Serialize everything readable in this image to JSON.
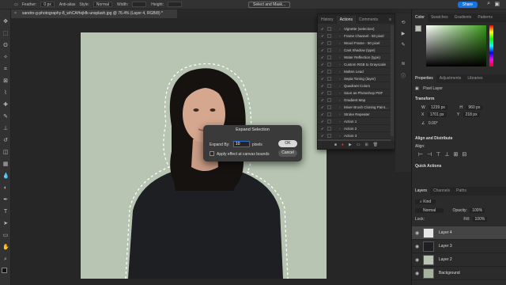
{
  "options_bar": {
    "feather_label": "Feather:",
    "feather_value": "0 px",
    "antialias_label": "Anti-alias",
    "style_label": "Style:",
    "style_value": "Normal",
    "width_label": "Width:",
    "height_label": "Height:",
    "select_mask_label": "Select and Mask...",
    "share_label": "Share"
  },
  "document_tab": {
    "title": "sandro-g-photography-8_whCAHejkfk-unsplash.jpg @ 76.4% (Layer 4, RGB/8) *"
  },
  "actions_panel": {
    "tabs": [
      "History",
      "Actions",
      "Comments"
    ],
    "active_tab": "Actions",
    "items": [
      "Vignette (selection)",
      "Frame Channel - 50 pixel",
      "Wood Frame - 50 pixel",
      "Cast Shadow (type)",
      "Water Reflection (type)",
      "Custom RGB to Grayscale",
      "Molten Lead",
      "Sepia Toning (layer)",
      "Quadrant Colors",
      "Save as Photoshop PDF",
      "Gradient Map",
      "Mixer Brush Cloning Paint...",
      "Stroke Repeater",
      "Action 1",
      "Action 2",
      "Action 3",
      "Repeated Outline"
    ],
    "selected_item": "Repeated Outline"
  },
  "dialog": {
    "title": "Expand Selection",
    "expand_label": "Expand By:",
    "expand_value": "10",
    "unit": "pixels",
    "checkbox_label": "Apply effect at canvas bounds",
    "ok_label": "OK",
    "cancel_label": "Cancel"
  },
  "color_panel": {
    "tabs": [
      "Color",
      "Swatches",
      "Gradients",
      "Patterns"
    ],
    "foreground": "#b7c5b2"
  },
  "properties_panel": {
    "tabs": [
      "Properties",
      "Adjustments",
      "Libraries"
    ],
    "kind": "Pixel Layer",
    "transform_header": "Transform",
    "w_label": "W",
    "w_value": "1239 px",
    "h_label": "H",
    "h_value": "960 px",
    "x_label": "X",
    "x_value": "1701 px",
    "y_label": "Y",
    "y_value": "218 px",
    "angle_value": "0.00°",
    "align_header": "Align and Distribute",
    "align_sub": "Align:",
    "quick_actions_header": "Quick Actions"
  },
  "layers_panel": {
    "tabs": [
      "Layers",
      "Channels",
      "Paths"
    ],
    "kind_label": "Kind",
    "blend_mode": "Normal",
    "opacity_label": "Opacity:",
    "opacity_value": "100%",
    "lock_label": "Lock:",
    "fill_label": "Fill:",
    "fill_value": "100%",
    "layers": [
      "Layer 4",
      "Layer 3",
      "Layer 2",
      "Background"
    ],
    "selected_layer": "Layer 4"
  }
}
